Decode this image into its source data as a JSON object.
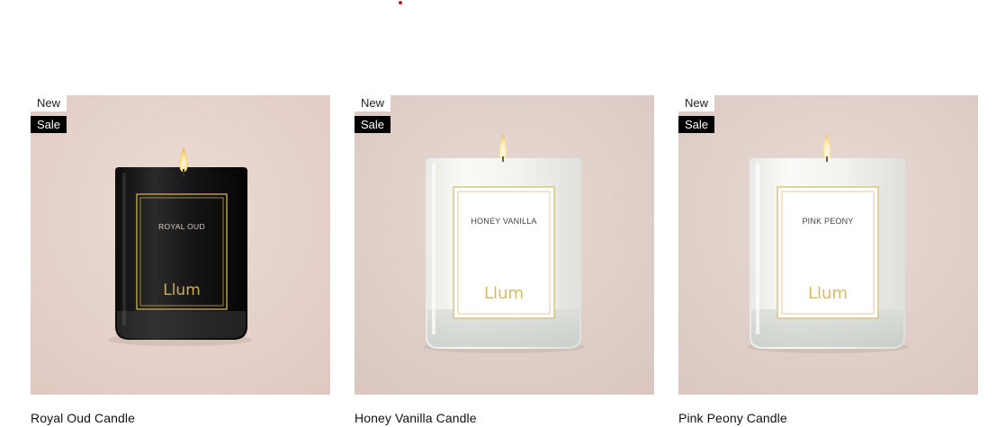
{
  "colors": {
    "background": "#ffffff",
    "accent_red": "#c8102e",
    "sale_badge_bg": "#000000",
    "new_badge_bg": "#ffffff"
  },
  "products": [
    {
      "title": "Royal Oud Candle",
      "badges": {
        "new": "New",
        "sale": "Sale"
      },
      "label_text": "ROYAL OUD",
      "brand": "Llum",
      "jar_style": "black-glass",
      "background": "#e8d6cf"
    },
    {
      "title": "Honey Vanilla Candle",
      "badges": {
        "new": "New",
        "sale": "Sale"
      },
      "label_text": "HONEY VANILLA",
      "brand": "Llum",
      "jar_style": "clear-glass",
      "background": "#e2d2cc"
    },
    {
      "title": "Pink Peony Candle",
      "badges": {
        "new": "New",
        "sale": "Sale"
      },
      "label_text": "PINK PEONY",
      "brand": "Llum",
      "jar_style": "clear-glass",
      "background": "#e2d3cd"
    }
  ]
}
